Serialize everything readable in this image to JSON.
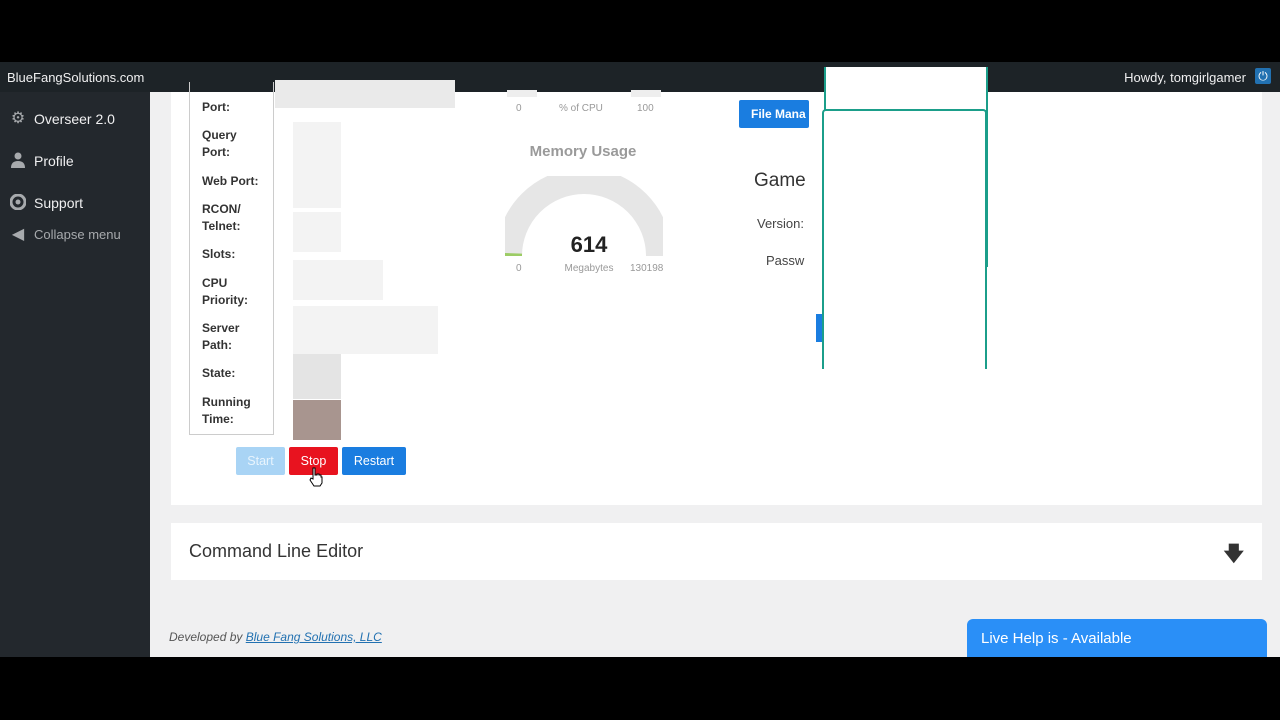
{
  "adminbar": {
    "site_name": "BlueFangSolutions.com",
    "greeting": "Howdy, tomgirlgamer"
  },
  "sidebar": {
    "items": [
      {
        "label": "Overseer 2.0",
        "icon": "gear-icon"
      },
      {
        "label": "Profile",
        "icon": "user-icon"
      },
      {
        "label": "Support",
        "icon": "lifebuoy-icon"
      },
      {
        "label": "Collapse menu",
        "icon": "collapse-icon"
      }
    ]
  },
  "server_info": {
    "labels": [
      "Port:",
      "Query Port:",
      "Web Port:",
      "RCON/ Telnet:",
      "Slots:",
      "CPU Priority:",
      "Server Path:",
      "State:",
      "Running Time:"
    ]
  },
  "controls": {
    "start": "Start",
    "stop": "Stop",
    "restart": "Restart"
  },
  "cpu_gauge": {
    "min": "0",
    "unit": "% of CPU",
    "max": "100"
  },
  "memory_gauge": {
    "title": "Memory Usage",
    "value": "614",
    "unit": "Megabytes",
    "min": "0",
    "max": "130198",
    "fraction": 0.0047
  },
  "right_panel": {
    "file_button": "File Mana",
    "game_title": "Game",
    "version_label": "Version:",
    "password_label": "Passw"
  },
  "command_line": {
    "title": "Command Line Editor"
  },
  "footer": {
    "prefix": "Developed by",
    "link": "Blue Fang Solutions, LLC"
  },
  "live_help": {
    "label": "Live Help is - Available"
  },
  "colors": {
    "stop": "#e8131f",
    "primary": "#1a7de0",
    "overlay_border": "#1b9e8a"
  }
}
